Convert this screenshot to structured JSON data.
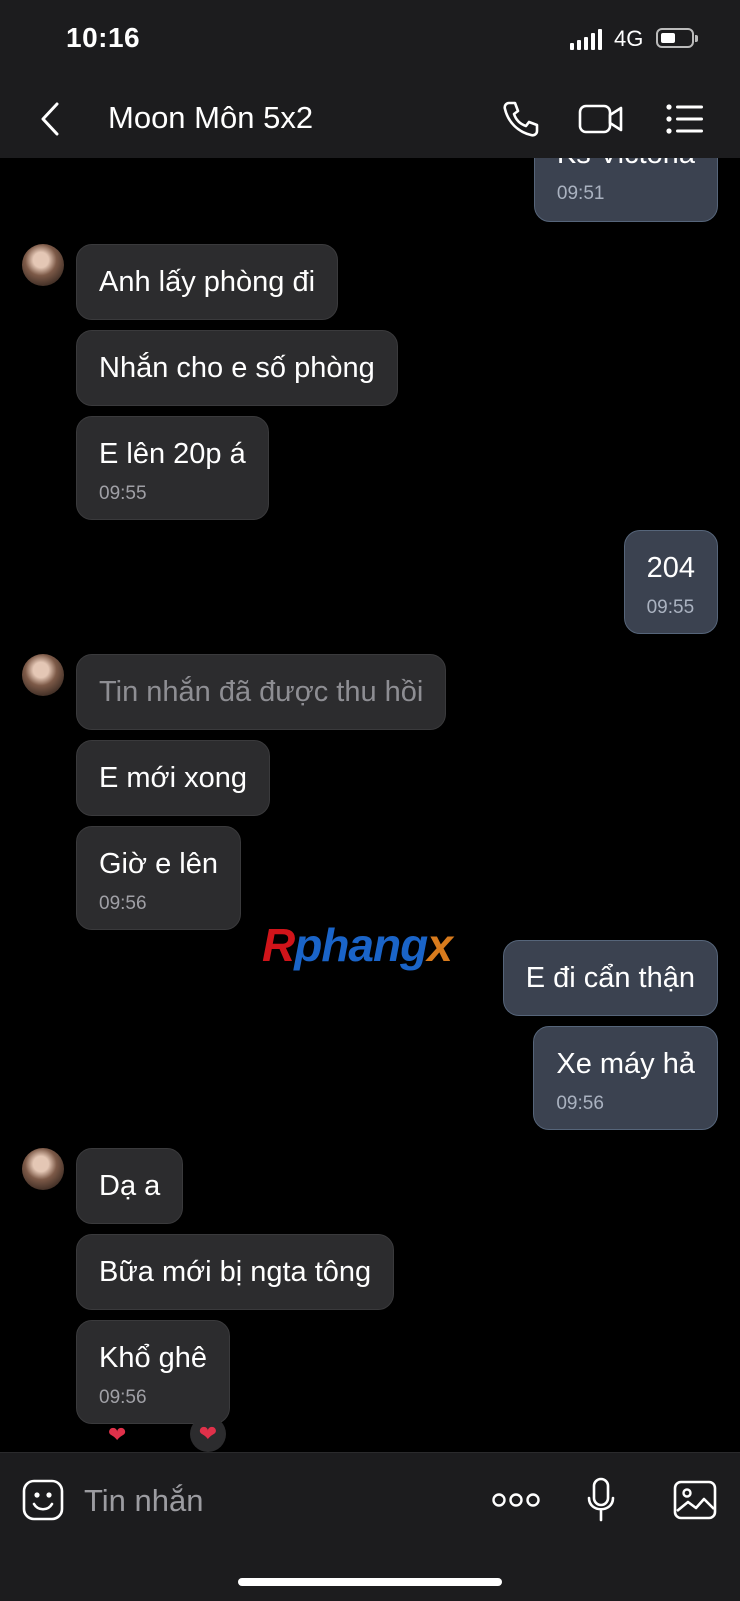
{
  "status_bar": {
    "time": "10:16",
    "network": "4G"
  },
  "header": {
    "title": "Moon Môn 5x2"
  },
  "messages": [
    {
      "text": "Ks Victoria",
      "time": "09:51"
    },
    {
      "text": "Anh lấy phòng đi"
    },
    {
      "text": "Nhắn cho e số phòng"
    },
    {
      "text": "E lên 20p á",
      "time": "09:55"
    },
    {
      "text": "204",
      "time": "09:55"
    },
    {
      "text": "Tin nhắn đã được thu hồi"
    },
    {
      "text": "E mới xong"
    },
    {
      "text": "Giờ e lên",
      "time": "09:56"
    },
    {
      "text": "E đi cẩn thận"
    },
    {
      "text": "Xe máy hả",
      "time": "09:56"
    },
    {
      "text": "Dạ a"
    },
    {
      "text": "Bữa mới bị ngta tông"
    },
    {
      "text": "Khổ ghê",
      "time": "09:56"
    }
  ],
  "watermark": {
    "part1": "R",
    "part2": "phang",
    "part3": "x"
  },
  "composer": {
    "placeholder": "Tin nhắn"
  }
}
